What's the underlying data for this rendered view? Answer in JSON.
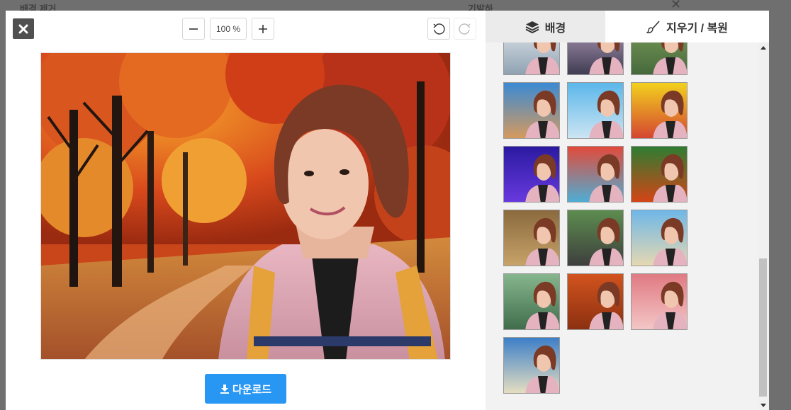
{
  "backdrop": {
    "left_text": "배경 제거",
    "right_text": "기발하"
  },
  "editor": {
    "zoom_level": "100 %",
    "download_label": "다운로드"
  },
  "side_panel": {
    "tabs": [
      {
        "label": "배경",
        "icon": "layers-icon"
      },
      {
        "label": "지우기 / 복원",
        "icon": "brush-icon"
      }
    ],
    "thumbnails": [
      {
        "name": "snow-mountain",
        "bg": [
          "#e9eef2",
          "#8da0b0"
        ]
      },
      {
        "name": "purple-mountain",
        "bg": [
          "#b9a2c2",
          "#3d3a4f"
        ]
      },
      {
        "name": "garden-path",
        "bg": [
          "#7ea05c",
          "#45683b"
        ]
      },
      {
        "name": "city-skyline",
        "bg": [
          "#3a8ad4",
          "#d99a5b"
        ]
      },
      {
        "name": "blue-sky-city",
        "bg": [
          "#5bb7ea",
          "#cfe6f3"
        ]
      },
      {
        "name": "rainbow-stripes",
        "bg": [
          "#f2d11d",
          "#d44232"
        ]
      },
      {
        "name": "purple-lights",
        "bg": [
          "#2a1aa0",
          "#6a3ae0"
        ]
      },
      {
        "name": "graffiti",
        "bg": [
          "#e24a3a",
          "#4ab0d8"
        ]
      },
      {
        "name": "color-stripes",
        "bg": [
          "#2e7d32",
          "#d84315"
        ]
      },
      {
        "name": "wooden-cabin",
        "bg": [
          "#8a6a3e",
          "#c9a46a"
        ]
      },
      {
        "name": "forest-road",
        "bg": [
          "#5d8d4f",
          "#3d3d3d"
        ]
      },
      {
        "name": "palm-beach",
        "bg": [
          "#6fb7e8",
          "#e8d9b0"
        ]
      },
      {
        "name": "lake-pavilion",
        "bg": [
          "#86b68d",
          "#3f6b4a"
        ]
      },
      {
        "name": "autumn-forest",
        "bg": [
          "#d2531e",
          "#8a2f10"
        ]
      },
      {
        "name": "bokeh-pink",
        "bg": [
          "#e07a82",
          "#f4c8c8"
        ]
      },
      {
        "name": "tropical-beach",
        "bg": [
          "#3d7fc8",
          "#e9e0c0"
        ]
      }
    ]
  },
  "colors": {
    "accent": "#2896f3",
    "panel": "#f2f2f2"
  }
}
